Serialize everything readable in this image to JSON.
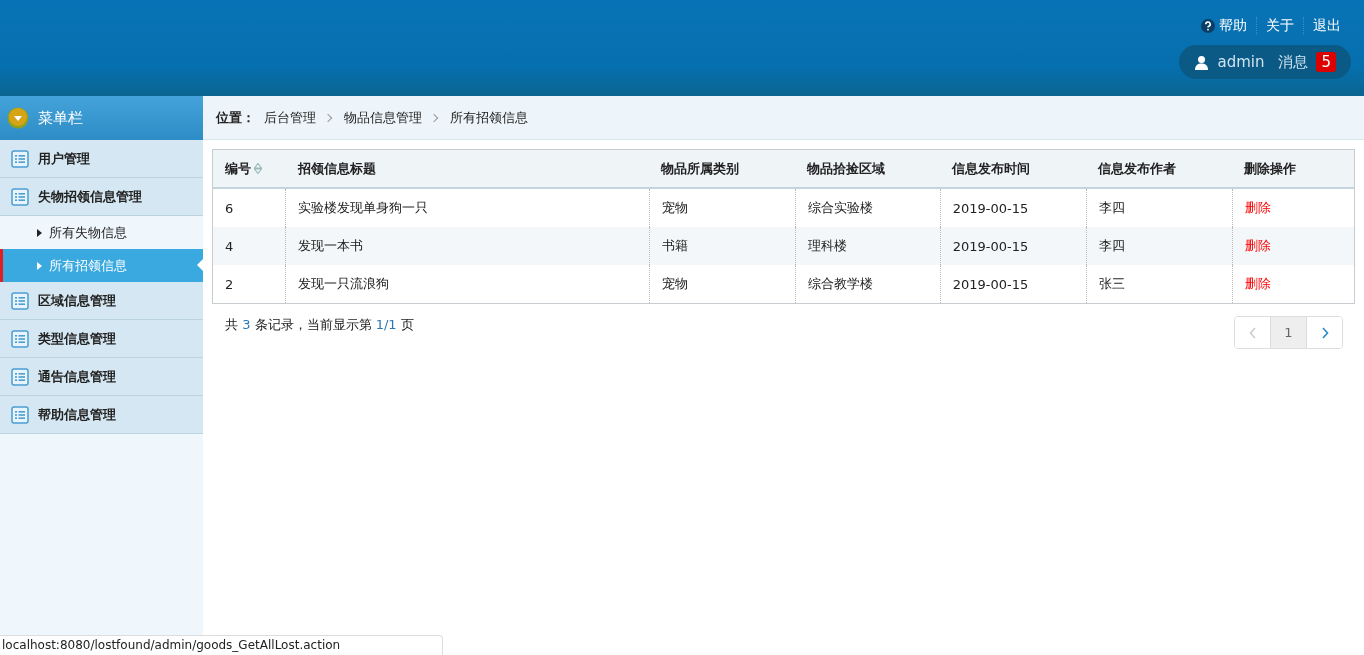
{
  "header": {
    "links": [
      {
        "label": "帮助"
      },
      {
        "label": "关于"
      },
      {
        "label": "退出"
      }
    ],
    "user": "admin",
    "messages_label": "消息",
    "messages_count": "5"
  },
  "sidebar": {
    "title": "菜单栏",
    "items": [
      {
        "label": "用户管理"
      },
      {
        "label": "失物招领信息管理",
        "children": [
          {
            "label": "所有失物信息",
            "selected": false
          },
          {
            "label": "所有招领信息",
            "selected": true
          }
        ]
      },
      {
        "label": "区域信息管理"
      },
      {
        "label": "类型信息管理"
      },
      {
        "label": "通告信息管理"
      },
      {
        "label": "帮助信息管理"
      }
    ]
  },
  "breadcrumb": {
    "label": "位置：",
    "items": [
      "后台管理",
      "物品信息管理",
      "所有招领信息"
    ]
  },
  "table": {
    "columns": [
      {
        "label": "编号",
        "sortable": true
      },
      {
        "label": "招领信息标题",
        "sortable": false
      },
      {
        "label": "物品所属类别",
        "sortable": false
      },
      {
        "label": "物品拾捡区域",
        "sortable": false
      },
      {
        "label": "信息发布时间",
        "sortable": false
      },
      {
        "label": "信息发布作者",
        "sortable": false
      },
      {
        "label": "删除操作",
        "sortable": false
      }
    ],
    "rows": [
      {
        "cells": [
          "6",
          "实验楼发现单身狗一只",
          "宠物",
          "综合实验楼",
          "2019-00-15",
          "李四"
        ],
        "action": "删除"
      },
      {
        "cells": [
          "4",
          "发现一本书",
          "书籍",
          "理科楼",
          "2019-00-15",
          "李四"
        ],
        "action": "删除"
      },
      {
        "cells": [
          "2",
          "发现一只流浪狗",
          "宠物",
          "综合教学楼",
          "2019-00-15",
          "张三"
        ],
        "action": "删除"
      }
    ]
  },
  "summary": {
    "parts": [
      "共",
      "3",
      "条记录，当前显示第",
      "1/1",
      "页"
    ]
  },
  "pagination": {
    "prev_disabled": true,
    "pages": [
      {
        "label": "1",
        "selected": true
      }
    ],
    "next_disabled": false
  },
  "status_bar": "localhost:8080/lostfound/admin/goods_GetAllLost.action"
}
